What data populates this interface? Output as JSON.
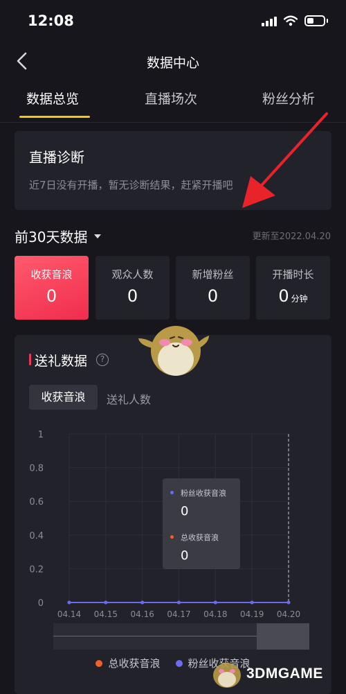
{
  "status_bar": {
    "time": "12:08"
  },
  "nav": {
    "title": "数据中心"
  },
  "tabs": [
    {
      "label": "数据总览",
      "active": true
    },
    {
      "label": "直播场次",
      "active": false
    },
    {
      "label": "粉丝分析",
      "active": false
    }
  ],
  "diagnosis": {
    "title": "直播诊断",
    "description": "近7日没有开播，暂无诊断结果，赶紧开播吧"
  },
  "period": {
    "label": "前30天数据",
    "update_time": "更新至2022.04.20"
  },
  "stats": [
    {
      "label": "收获音浪",
      "value": "0",
      "unit": "",
      "selected": true
    },
    {
      "label": "观众人数",
      "value": "0",
      "unit": ""
    },
    {
      "label": "新增粉丝",
      "value": "0",
      "unit": ""
    },
    {
      "label": "开播时长",
      "value": "0",
      "unit": "分钟"
    }
  ],
  "gift_section": {
    "title": "送礼数据",
    "help_icon": "?",
    "segments": [
      {
        "label": "收获音浪",
        "active": true
      },
      {
        "label": "送礼人数",
        "active": false
      }
    ]
  },
  "tooltip": {
    "items": [
      {
        "label": "粉丝收获音浪",
        "value": "0",
        "color": "#6b6bf0"
      },
      {
        "label": "总收获音浪",
        "value": "0",
        "color": "#f0602a"
      }
    ]
  },
  "legend": [
    {
      "label": "总收获音浪",
      "color": "#f0602a"
    },
    {
      "label": "粉丝收获音浪",
      "color": "#6b6bf0"
    }
  ],
  "chart_data": {
    "type": "line",
    "categories": [
      "04.14",
      "04.15",
      "04.16",
      "04.17",
      "04.18",
      "04.19",
      "04.20"
    ],
    "series": [
      {
        "name": "总收获音浪",
        "values": [
          0,
          0,
          0,
          0,
          0,
          0,
          0
        ],
        "color": "#f0602a"
      },
      {
        "name": "粉丝收获音浪",
        "values": [
          0,
          0,
          0,
          0,
          0,
          0,
          0
        ],
        "color": "#6b6bf0"
      }
    ],
    "yticks": [
      "0",
      "0.2",
      "0.4",
      "0.6",
      "0.8",
      "1"
    ],
    "ylim": [
      0,
      1
    ],
    "grid": true,
    "highlight_category": "04.20"
  },
  "icons": {
    "back": "chevron-left-icon",
    "signal": "cellular-signal-icon",
    "wifi": "wifi-icon",
    "battery": "battery-icon",
    "dropdown": "caret-down-icon",
    "help": "question-circle-icon"
  },
  "watermark": {
    "text": "3DMGAME"
  }
}
